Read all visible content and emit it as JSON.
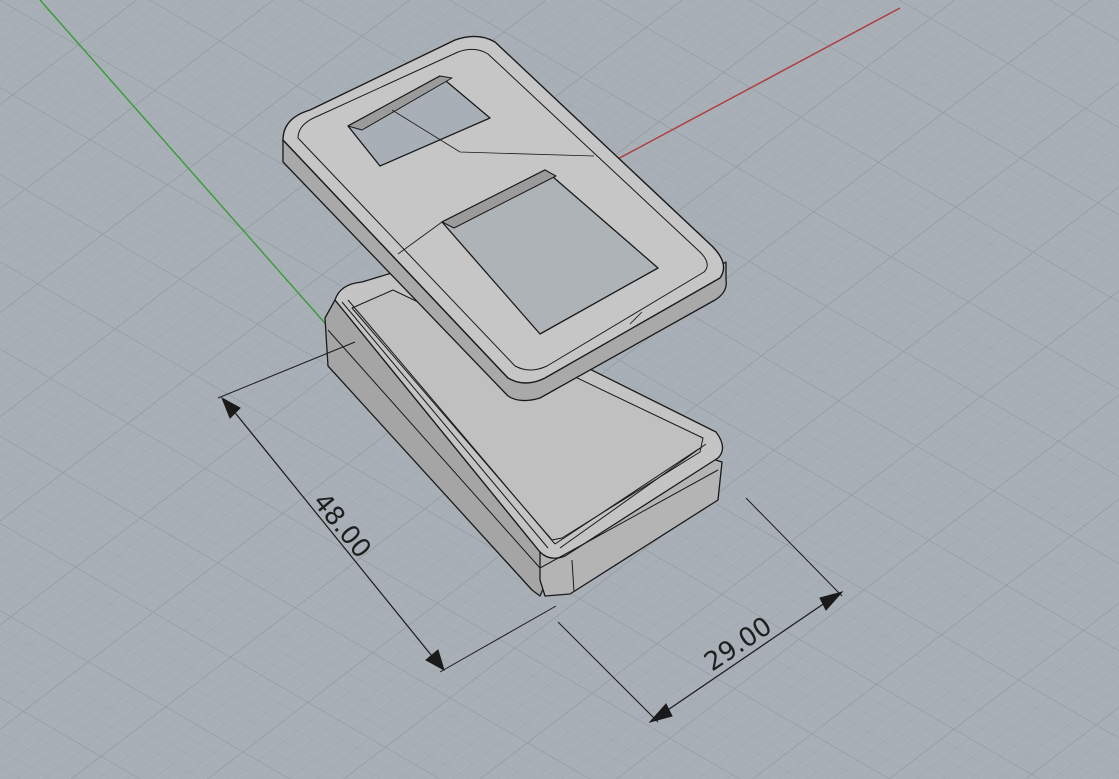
{
  "viewport": {
    "background": "#a8afb6",
    "grid_minor_color": "#9ea6ad",
    "grid_major_color": "#8c949b",
    "x_axis_color": "#b03a3a",
    "y_axis_color": "#3a9a3a"
  },
  "model": {
    "parts": [
      "enclosure-lid",
      "enclosure-base"
    ],
    "shade_light": "#c9c9c9",
    "shade_dark": "#9a9a9a",
    "edge_color": "#1a1a1a"
  },
  "dimensions": {
    "length_label": "48.00",
    "width_label": "29.00",
    "line_color": "#1a1a1a"
  }
}
